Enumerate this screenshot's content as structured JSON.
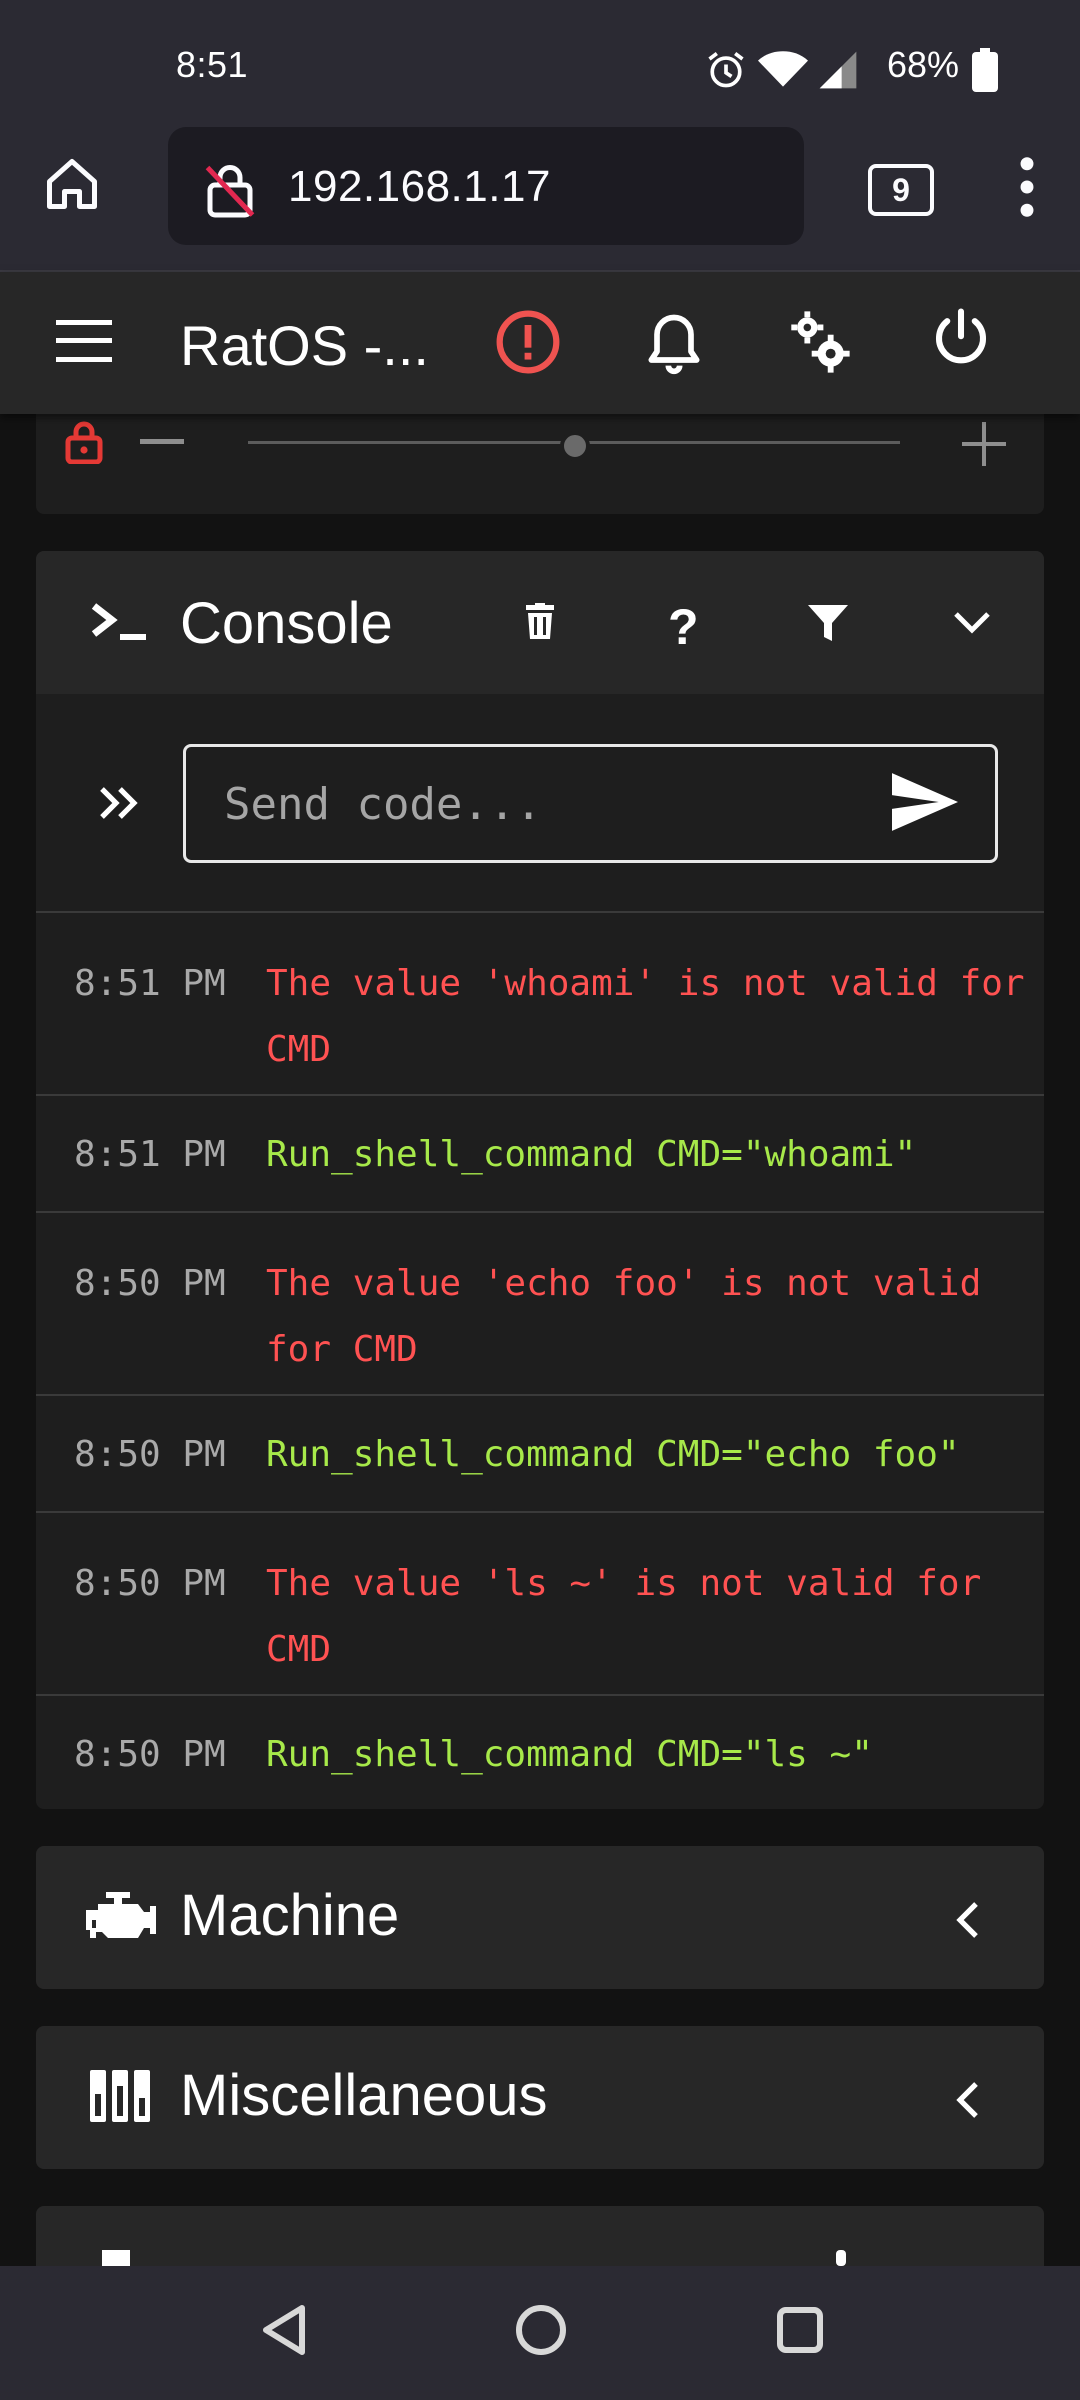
{
  "status_bar": {
    "time": "8:51",
    "battery": "68%"
  },
  "browser": {
    "url": "192.168.1.17",
    "tab_count": "9"
  },
  "app_bar": {
    "title": "RatOS -..."
  },
  "console": {
    "title": "Console",
    "input_placeholder": "Send code...",
    "entries": [
      {
        "time": "8:51 PM",
        "text": "The value 'whoami' is not valid for CMD",
        "type": "error"
      },
      {
        "time": "8:51 PM",
        "text": "Run_shell_command CMD=\"whoami\"",
        "type": "command"
      },
      {
        "time": "8:50 PM",
        "text": "The value 'echo foo' is not valid for CMD",
        "type": "error"
      },
      {
        "time": "8:50 PM",
        "text": "Run_shell_command CMD=\"echo foo\"",
        "type": "command"
      },
      {
        "time": "8:50 PM",
        "text": "The value 'ls ~' is not valid for CMD",
        "type": "error"
      },
      {
        "time": "8:50 PM",
        "text": "Run_shell_command CMD=\"ls ~\"",
        "type": "command"
      }
    ]
  },
  "panels": {
    "machine": "Machine",
    "miscellaneous": "Miscellaneous"
  },
  "colors": {
    "error": "#ff5252",
    "command": "#a7e94a",
    "alert": "#ef5350"
  }
}
